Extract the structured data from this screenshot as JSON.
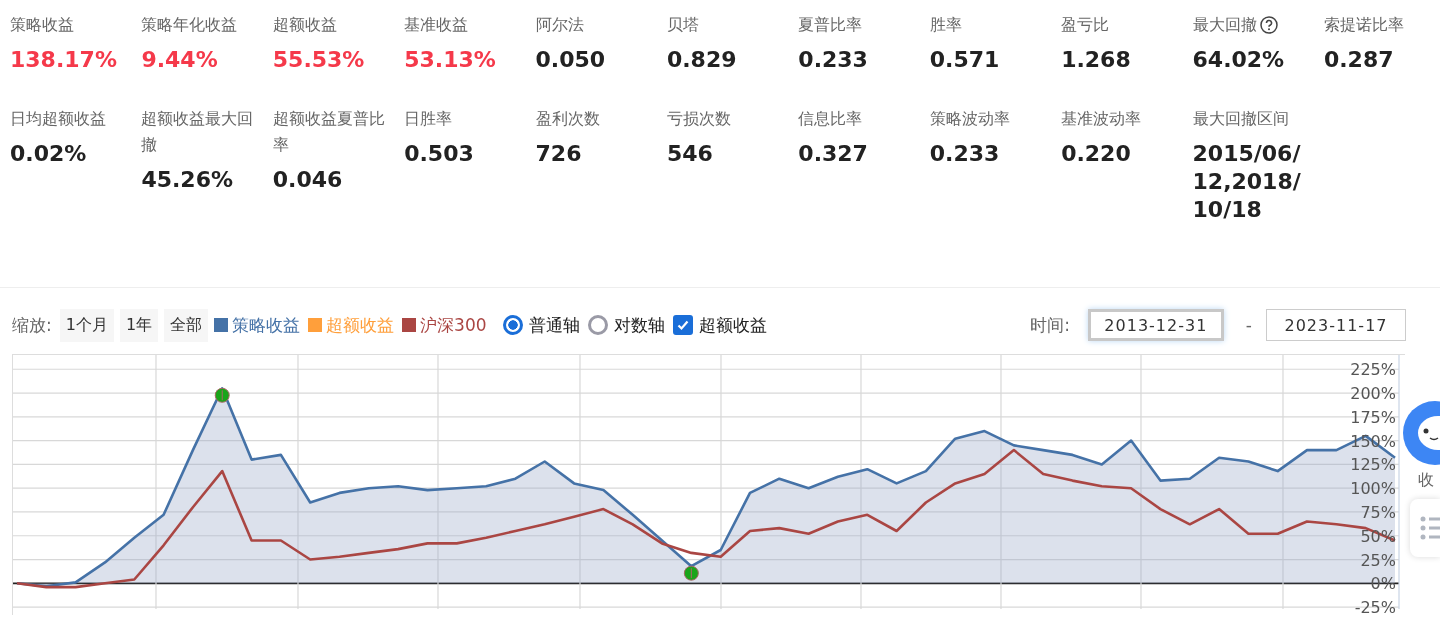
{
  "metrics": [
    {
      "label": "策略收益",
      "value": "138.17%",
      "color": "#f5394a"
    },
    {
      "label": "策略年化收益",
      "value": "9.44%",
      "color": "#f5394a"
    },
    {
      "label": "超额收益",
      "value": "55.53%",
      "color": "#f5394a"
    },
    {
      "label": "基准收益",
      "value": "53.13%",
      "color": "#f5394a"
    },
    {
      "label": "阿尔法",
      "value": "0.050",
      "color": "#222222"
    },
    {
      "label": "贝塔",
      "value": "0.829",
      "color": "#222222"
    },
    {
      "label": "夏普比率",
      "value": "0.233",
      "color": "#222222"
    },
    {
      "label": "胜率",
      "value": "0.571",
      "color": "#222222"
    },
    {
      "label": "盈亏比",
      "value": "1.268",
      "color": "#222222"
    },
    {
      "label": "最大回撤",
      "value": "64.02%",
      "color": "#222222",
      "help": true
    },
    {
      "label": "索提诺比率",
      "value": "0.287",
      "color": "#222222"
    },
    {
      "label": "日均超额收益",
      "value": "0.02%",
      "color": "#222222"
    },
    {
      "label": "超额收益最大回撤",
      "value": "45.26%",
      "color": "#222222"
    },
    {
      "label": "超额收益夏普比率",
      "value": "0.046",
      "color": "#222222"
    },
    {
      "label": "日胜率",
      "value": "0.503",
      "color": "#222222"
    },
    {
      "label": "盈利次数",
      "value": "726",
      "color": "#222222"
    },
    {
      "label": "亏损次数",
      "value": "546",
      "color": "#222222"
    },
    {
      "label": "信息比率",
      "value": "0.327",
      "color": "#222222"
    },
    {
      "label": "策略波动率",
      "value": "0.233",
      "color": "#222222"
    },
    {
      "label": "基准波动率",
      "value": "0.220",
      "color": "#222222"
    },
    {
      "label": "最大回撤区间",
      "value": "2015/06/12,2018/10/18",
      "color": "#222222"
    }
  ],
  "zoom": {
    "label": "缩放:",
    "buttons": [
      "1个月",
      "1年",
      "全部"
    ]
  },
  "excess_legend": {
    "label": "超额收益",
    "color": "#ff9f3b"
  },
  "axis_options": [
    {
      "kind": "radio",
      "label": "普通轴",
      "selected": true
    },
    {
      "kind": "radio",
      "label": "对数轴",
      "selected": false
    },
    {
      "kind": "checkbox",
      "label": "超额收益",
      "checked": true
    }
  ],
  "time_range": {
    "label": "时间:",
    "start": "2013-12-31",
    "separator": "-",
    "end": "2023-11-17"
  },
  "chart": {
    "chart_data": {
      "type": "line",
      "grid": true,
      "ylim": [
        -27,
        240
      ],
      "yticks": [
        {
          "value": -25,
          "label": "-25%"
        },
        {
          "value": 0,
          "label": "0%"
        },
        {
          "value": 25,
          "label": "25%"
        },
        {
          "value": 50,
          "label": "50%"
        },
        {
          "value": 75,
          "label": "75%"
        },
        {
          "value": 100,
          "label": "100%"
        },
        {
          "value": 125,
          "label": "125%"
        },
        {
          "value": 150,
          "label": "150%"
        },
        {
          "value": 175,
          "label": "175%"
        },
        {
          "value": 200,
          "label": "200%"
        },
        {
          "value": 225,
          "label": "225%"
        }
      ],
      "series": [
        {
          "name": "策略收益",
          "type": "area",
          "color": "#4572a7",
          "values": [
            0,
            -3,
            1,
            22,
            48,
            72,
            140,
            205,
            130,
            135,
            85,
            95,
            100,
            102,
            98,
            100,
            102,
            110,
            128,
            105,
            98,
            72,
            45,
            18,
            35,
            95,
            110,
            100,
            112,
            120,
            105,
            118,
            152,
            160,
            145,
            140,
            135,
            125,
            150,
            108,
            110,
            132,
            128,
            118,
            140,
            140,
            155,
            132
          ]
        },
        {
          "name": "沪深300",
          "type": "line",
          "color": "#aa4643",
          "values": [
            0,
            -4,
            -4,
            0,
            4,
            40,
            80,
            118,
            45,
            45,
            25,
            28,
            32,
            36,
            42,
            42,
            48,
            55,
            62,
            70,
            78,
            62,
            42,
            32,
            28,
            55,
            58,
            52,
            65,
            72,
            55,
            85,
            105,
            115,
            140,
            115,
            108,
            102,
            100,
            78,
            62,
            78,
            52,
            52,
            65,
            62,
            58,
            45
          ]
        }
      ]
    }
  },
  "side_widget": {
    "label": "收"
  }
}
